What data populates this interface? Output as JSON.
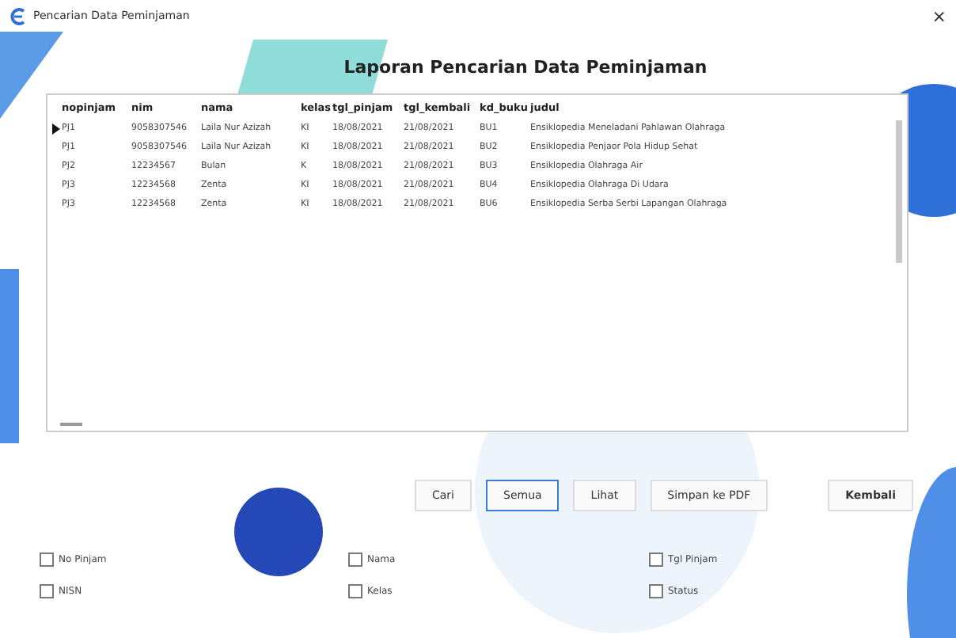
{
  "window": {
    "title": "Pencarian Data Peminjaman",
    "close": "×"
  },
  "heading": "Laporan Pencarian Data Peminjaman",
  "table": {
    "columns": [
      "nopinjam",
      "nim",
      "nama",
      "kelas",
      "tgl_pinjam",
      "tgl_kembali",
      "kd_buku",
      "judul"
    ],
    "rows": [
      {
        "selected": true,
        "cells": [
          "PJ1",
          "9058307546",
          "Laila Nur Azizah",
          "KI",
          "18/08/2021",
          "21/08/2021",
          "BU1",
          "Ensiklopedia Meneladani Pahlawan Olahraga"
        ]
      },
      {
        "selected": false,
        "cells": [
          "PJ1",
          "9058307546",
          "Laila Nur Azizah",
          "KI",
          "18/08/2021",
          "21/08/2021",
          "BU2",
          "Ensiklopedia Penjaor Pola Hidup Sehat"
        ]
      },
      {
        "selected": false,
        "cells": [
          "PJ2",
          "12234567",
          "Bulan",
          "K",
          "18/08/2021",
          "21/08/2021",
          "BU3",
          "Ensiklopedia Olahraga Air"
        ]
      },
      {
        "selected": false,
        "cells": [
          "PJ3",
          "12234568",
          "Zenta",
          "KI",
          "18/08/2021",
          "21/08/2021",
          "BU4",
          "Ensiklopedia Olahraga Di Udara"
        ]
      },
      {
        "selected": false,
        "cells": [
          "PJ3",
          "12234568",
          "Zenta",
          "KI",
          "18/08/2021",
          "21/08/2021",
          "BU6",
          "Ensiklopedia Serba Serbi Lapangan Olahraga"
        ]
      }
    ]
  },
  "buttons": [
    {
      "label": "Cari",
      "focused": false
    },
    {
      "label": "Semua",
      "focused": true
    },
    {
      "label": "Lihat",
      "focused": false
    },
    {
      "label": "Simpan ke PDF",
      "focused": false
    }
  ],
  "back_button": "Kembali",
  "checkboxes": [
    {
      "label": "No Pinjam",
      "checked": false
    },
    {
      "label": "Nama",
      "checked": false
    },
    {
      "label": "Tgl Pinjam",
      "checked": false
    },
    {
      "label": "NISN",
      "checked": false
    },
    {
      "label": "Kelas",
      "checked": false
    },
    {
      "label": "Status",
      "checked": false
    }
  ]
}
